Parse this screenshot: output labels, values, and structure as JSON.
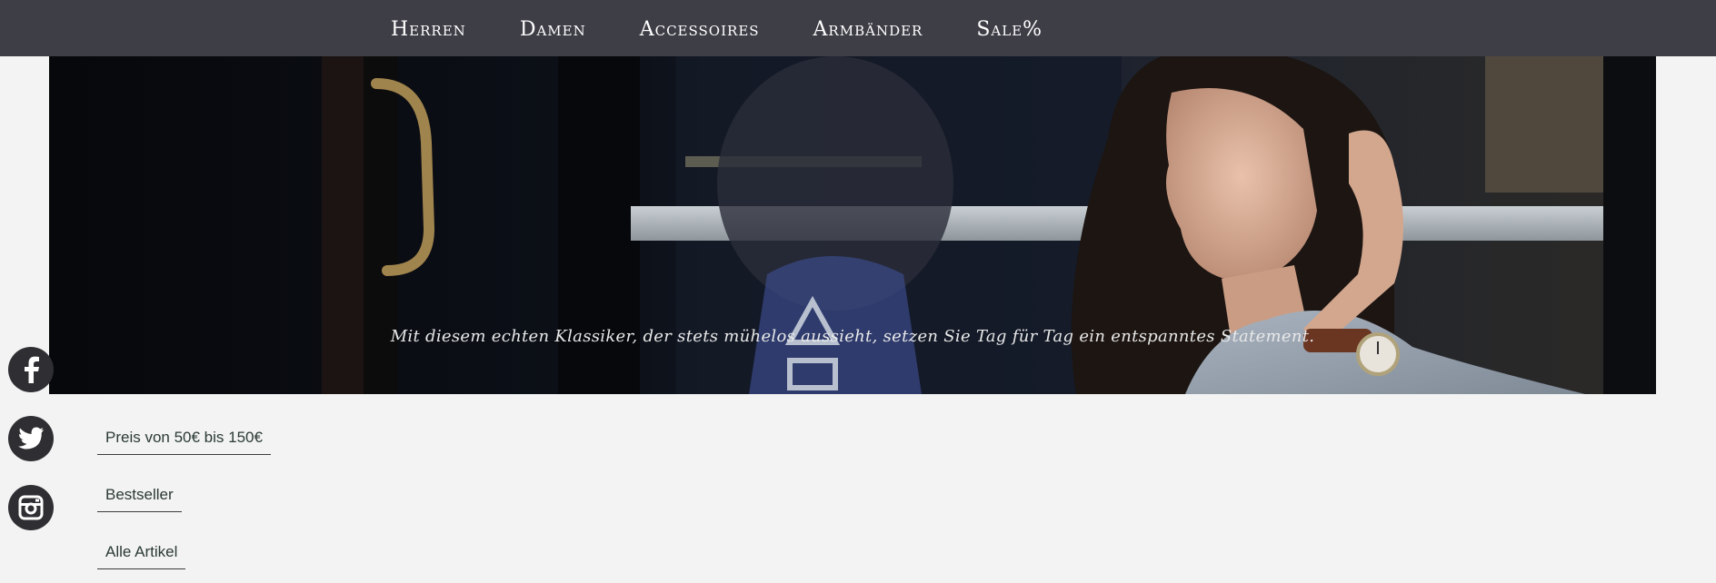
{
  "nav": {
    "items": [
      {
        "label": "Herren"
      },
      {
        "label": "Damen"
      },
      {
        "label": "Accessoires"
      },
      {
        "label": "Armbänder"
      },
      {
        "label": "Sale%"
      }
    ]
  },
  "hero": {
    "caption": "Mit diesem echten Klassiker, der stets mühelos aussieht, setzen Sie Tag für Tag ein entspanntes Statement."
  },
  "social": {
    "icons": [
      "facebook-icon",
      "twitter-icon",
      "instagram-icon"
    ]
  },
  "filters": {
    "items": [
      {
        "label": "Preis von 50€ bis 150€"
      },
      {
        "label": "Bestseller"
      },
      {
        "label": "Alle Artikel"
      }
    ]
  },
  "colors": {
    "nav_background": "#3e3e47",
    "page_background": "#f3f3f3",
    "social_icon_background": "#2f2f33"
  }
}
